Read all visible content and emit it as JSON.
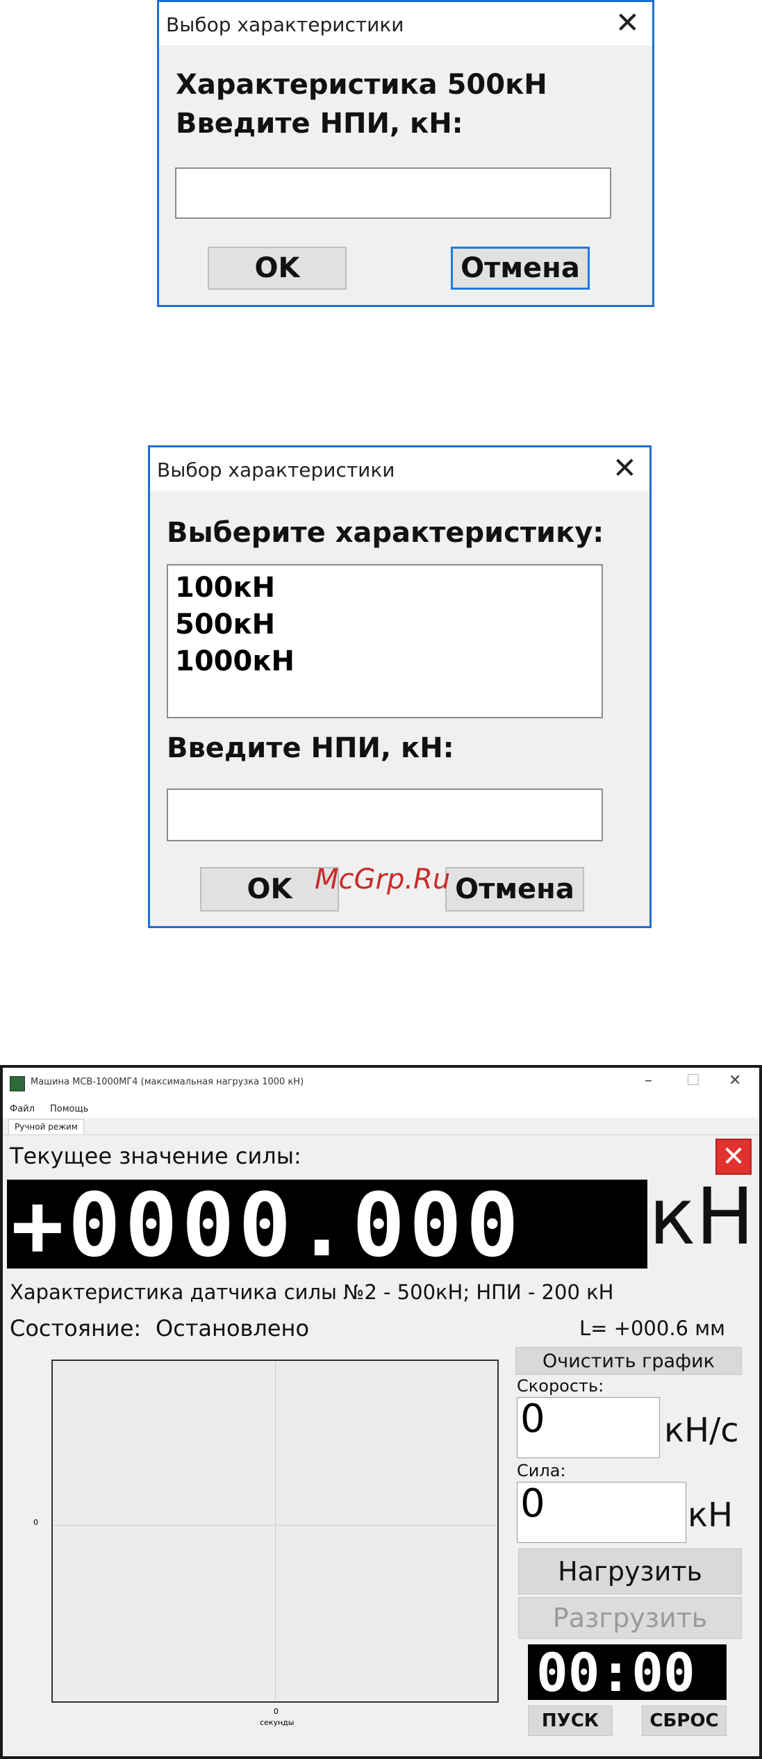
{
  "dialog1": {
    "title": "Выбор характеристики",
    "heading": "Характеристика 500кН",
    "prompt": "Введите НПИ, кН:",
    "input_value": "",
    "ok_label": "OK",
    "cancel_label": "Отмена"
  },
  "dialog2": {
    "title": "Выбор характеристики",
    "select_prompt": "Выберите характеристику:",
    "options": [
      "100кН",
      "500кН",
      "1000кН"
    ],
    "prompt": "Введите НПИ, кН:",
    "input_value": "",
    "ok_label": "OK",
    "cancel_label": "Отмена"
  },
  "watermark": "McGrp.Ru",
  "main": {
    "window_title": "Машина МСВ-1000МГ4 (максимальная нагрузка 1000 кН)",
    "menu": [
      "Файл",
      "Помощь"
    ],
    "tab": "Ручной режим",
    "force_label": "Текущее значение силы:",
    "force_display": "+0000.000",
    "force_unit": "кН",
    "sensor_info": "Характеристика датчика силы №2 - 500кН; НПИ - 200 кН",
    "state_label": "Состояние:",
    "state_value": "Остановлено",
    "length": "L= +000.6 мм",
    "clear_graph": "Очистить график",
    "speed_label": "Скорость:",
    "speed_value": "0",
    "speed_unit": "кН/с",
    "force_input_label": "Сила:",
    "force_input_value": "0",
    "force_input_unit": "кН",
    "load_button": "Нагрузить",
    "unload_button": "Разгрузить",
    "timer": "00:00",
    "start_button": "ПУСК",
    "reset_button": "СБРОС",
    "plot_y_tick": "0",
    "plot_x_tick": "0",
    "plot_x_unit": "секунды",
    "colors": {
      "close_red": "#e0332f",
      "dialog_border": "#1f6fd1"
    }
  }
}
